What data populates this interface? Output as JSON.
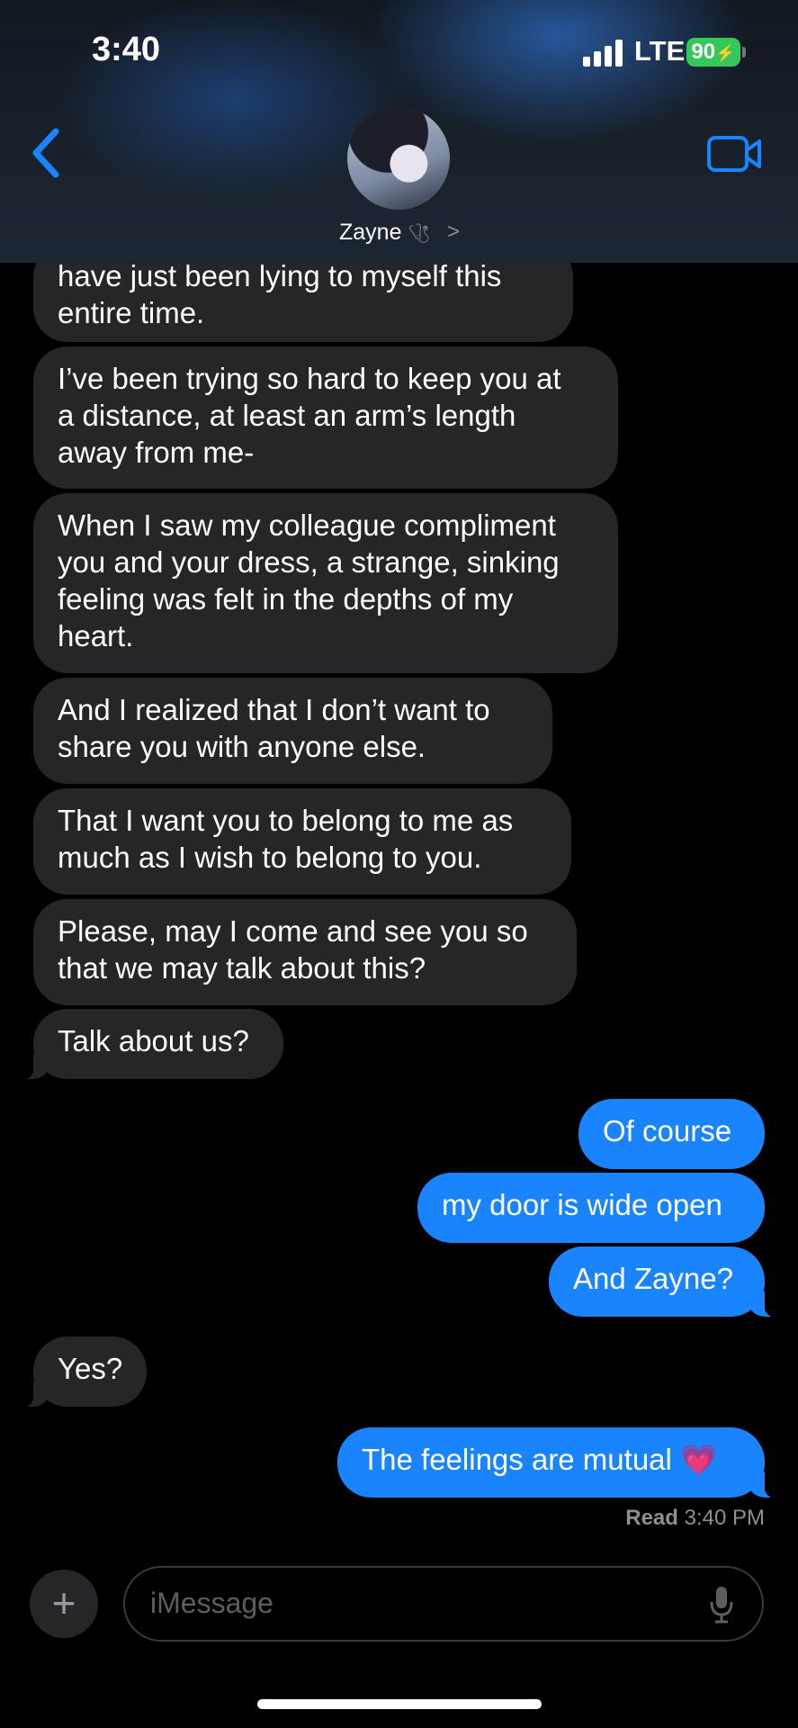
{
  "status_bar": {
    "time": "3:40",
    "network": "LTE",
    "battery": "90"
  },
  "header": {
    "contact_name": "Zayne",
    "contact_emoji": "🩺",
    "chevron": ">"
  },
  "messages": [
    {
      "dir": "in",
      "text": "have just been lying to myself this\nentire time."
    },
    {
      "dir": "in",
      "text": "I’ve been trying so hard to keep you at\na distance, at least an arm’s length\naway from me-"
    },
    {
      "dir": "in",
      "text": "When I saw my colleague compliment\nyou and your dress, a strange, sinking\nfeeling was felt in the depths of my\nheart."
    },
    {
      "dir": "in",
      "text": "And I realized that I don’t want to\nshare you with anyone else."
    },
    {
      "dir": "in",
      "text": "That I want you to belong to me as\nmuch as I wish to belong to you."
    },
    {
      "dir": "in",
      "text": "Please, may I come and see you so\nthat we may talk about this?"
    },
    {
      "dir": "in",
      "text": "Talk about us?"
    },
    {
      "dir": "out",
      "text": "Of course"
    },
    {
      "dir": "out",
      "text": "my door is wide open"
    },
    {
      "dir": "out",
      "text": "And Zayne?"
    },
    {
      "dir": "in",
      "text": "Yes?"
    },
    {
      "dir": "out",
      "text": "The feelings are mutual 💗"
    }
  ],
  "read_receipt": {
    "label": "Read",
    "time": "3:40 PM"
  },
  "composer": {
    "plus": "+",
    "placeholder": "iMessage"
  },
  "colors": {
    "incoming": "#262628",
    "outgoing": "#1a84ff",
    "accent": "#1a84ff",
    "battery": "#34c759"
  }
}
